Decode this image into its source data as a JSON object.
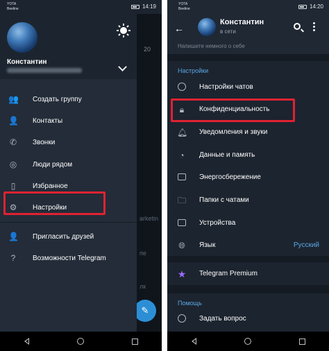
{
  "status_left": {
    "carrier": "YOTA",
    "carrier2": "Beeline",
    "time": "14:19"
  },
  "status_right": {
    "carrier": "YOTA",
    "carrier2": "Beeline",
    "time": "14:20"
  },
  "drawer": {
    "user_name": "Константин",
    "menu": [
      {
        "label": "Создать группу",
        "icon": "group-icon"
      },
      {
        "label": "Контакты",
        "icon": "person-icon"
      },
      {
        "label": "Звонки",
        "icon": "phone-icon"
      },
      {
        "label": "Люди рядом",
        "icon": "nearby-icon"
      },
      {
        "label": "Избранное",
        "icon": "bookmark-icon"
      },
      {
        "label": "Настройки",
        "icon": "gear-icon"
      },
      {
        "label": "Пригласить друзей",
        "icon": "add-person-icon"
      },
      {
        "label": "Возможности Telegram",
        "icon": "question-icon"
      }
    ]
  },
  "chatlist_fragments": [
    "20",
    "arketin",
    "пе",
    "лк"
  ],
  "settings": {
    "profile_name": "Константин",
    "profile_status": "в сети",
    "bio_placeholder": "Напишите немного о себе",
    "section_settings": "Настройки",
    "items": [
      {
        "label": "Настройки чатов",
        "icon": "chat-bubble-icon"
      },
      {
        "label": "Конфиденциальность",
        "icon": "lock-icon"
      },
      {
        "label": "Уведомления и звуки",
        "icon": "bell-icon"
      },
      {
        "label": "Данные и память",
        "icon": "clock-icon"
      },
      {
        "label": "Энергосбережение",
        "icon": "battery-icon"
      },
      {
        "label": "Папки с чатами",
        "icon": "folder-icon"
      },
      {
        "label": "Устройства",
        "icon": "devices-icon"
      },
      {
        "label": "Язык",
        "icon": "globe-icon",
        "value": "Русский"
      }
    ],
    "premium": "Telegram Premium",
    "section_help": "Помощь",
    "help_items": [
      {
        "label": "Задать вопрос",
        "icon": "chat-bubble-icon"
      }
    ]
  },
  "colors": {
    "highlight": "#e02231",
    "accent": "#5aa8e6",
    "premium_star": "#9b6bff"
  }
}
